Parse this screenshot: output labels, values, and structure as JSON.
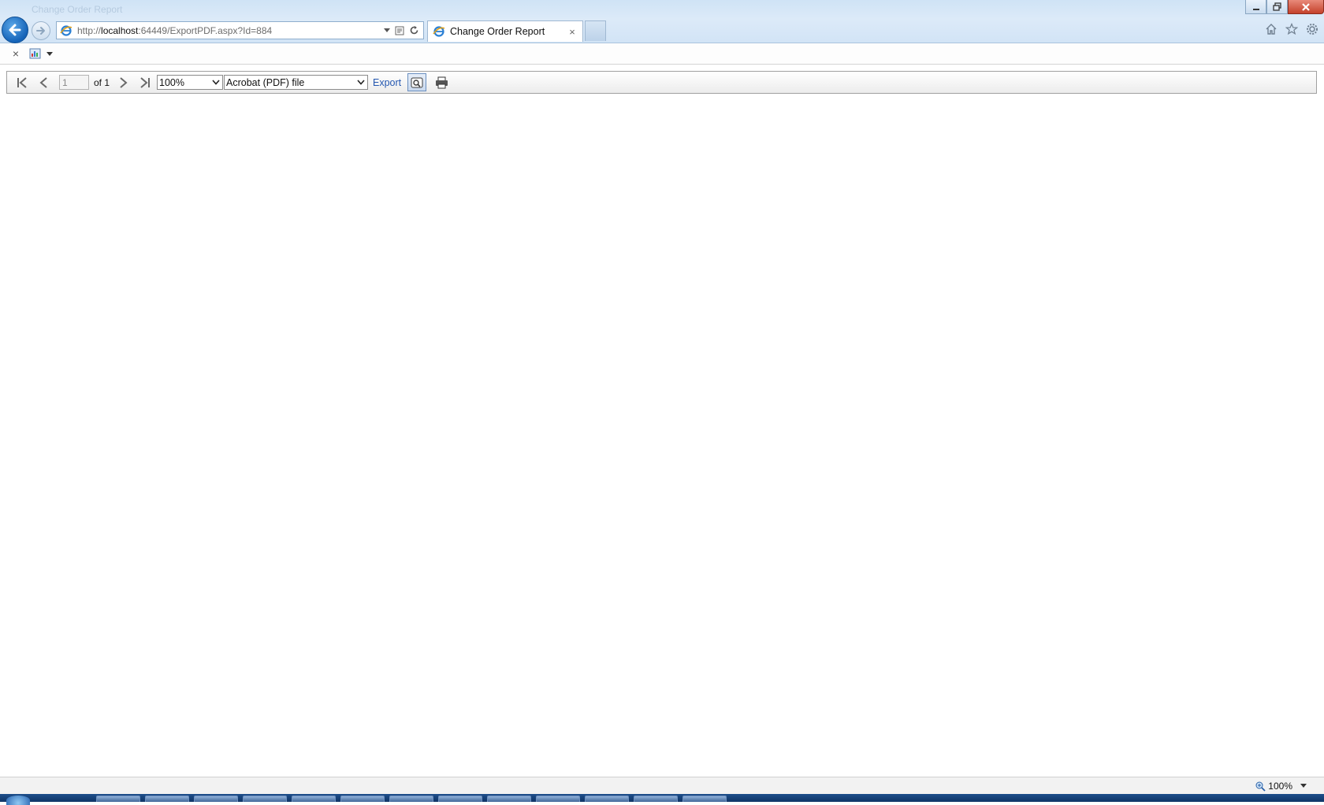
{
  "browser": {
    "ghost_title": "Change Order Report",
    "address": {
      "prefix": "http://",
      "host": "localhost",
      "rest": ":64449/ExportPDF.aspx?Id=884"
    },
    "tab": {
      "title": "Change Order Report",
      "close_glyph": "×"
    },
    "window_buttons": [
      "minimize",
      "restore",
      "close"
    ]
  },
  "command_bar": {
    "close_glyph": "×"
  },
  "report_toolbar": {
    "page_value": "1",
    "page_of": "of 1",
    "zoom_selected": "100%",
    "export_format_selected": "Acrobat (PDF) file",
    "export_label": "Export"
  },
  "status_bar": {
    "zoom_level": "100%"
  },
  "icons": {
    "back": "back-arrow-icon",
    "forward": "forward-arrow-icon",
    "ie": "ie-logo-icon",
    "home": "home-icon",
    "favorites": "star-icon",
    "tools": "gear-icon",
    "first_page": "first-page-icon",
    "prev_page": "previous-page-icon",
    "next_page": "next-page-icon",
    "last_page": "last-page-icon",
    "find": "find-icon",
    "print": "printer-icon"
  }
}
